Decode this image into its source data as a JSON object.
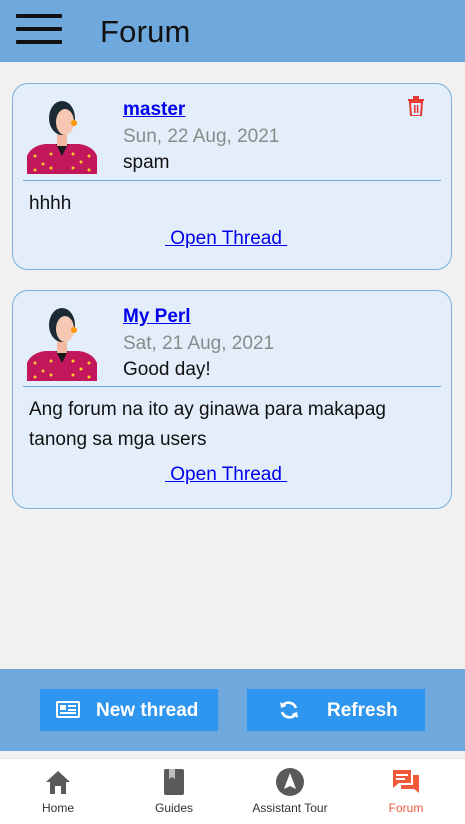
{
  "header": {
    "title": "Forum",
    "menu_icon": "hamburger-menu-icon"
  },
  "threads": [
    {
      "author": "master",
      "date": "Sun, 22 Aug, 2021",
      "subject": "spam",
      "body": "hhhh",
      "open_label": " Open Thread ",
      "deletable": true,
      "avatar_icon": "female-avatar-icon"
    },
    {
      "author": "My Perl",
      "date": "Sat, 21 Aug, 2021",
      "subject": "Good day!",
      "body": "Ang forum na ito ay ginawa para makapag tanong sa mga users",
      "open_label": " Open Thread ",
      "deletable": false,
      "avatar_icon": "female-avatar-icon"
    }
  ],
  "actions": {
    "new_thread": "New thread",
    "refresh": "Refresh"
  },
  "nav": [
    {
      "label": "Home",
      "icon": "home-icon",
      "active": false
    },
    {
      "label": "Guides",
      "icon": "book-icon",
      "active": false
    },
    {
      "label": "Assistant Tour",
      "icon": "navigation-icon",
      "active": false
    },
    {
      "label": "Forum",
      "icon": "forum-icon",
      "active": true
    }
  ],
  "colors": {
    "header": "#6fa8dc",
    "button": "#2f96f0",
    "active_nav": "#f05a3a",
    "link": "#0000ee",
    "delete": "#e53935"
  }
}
